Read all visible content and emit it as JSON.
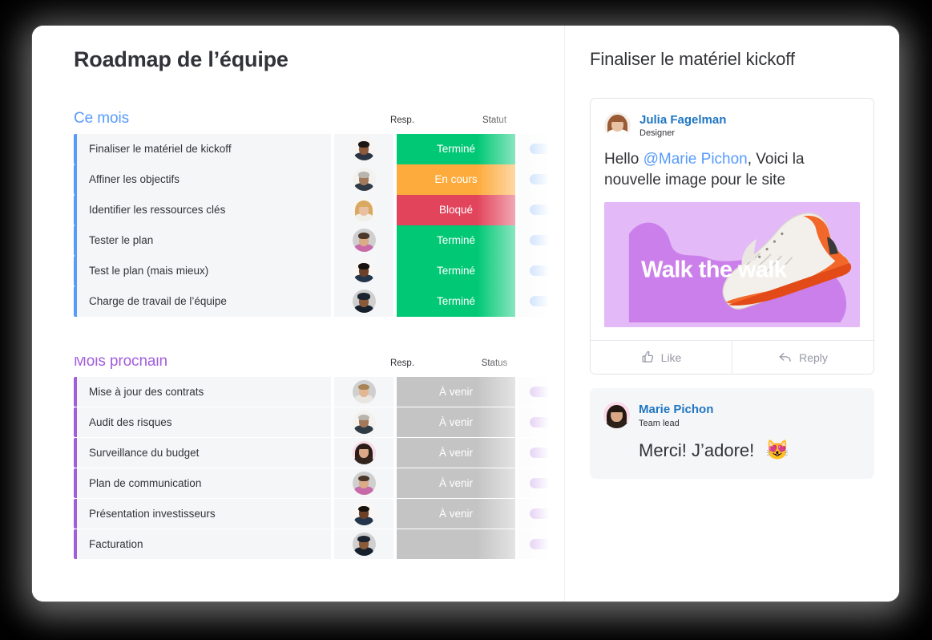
{
  "board": {
    "title": "Roadmap de l’équipe",
    "groups": [
      {
        "name": "Ce mois",
        "accent": "#579bfc",
        "columns": {
          "person": "Resp.",
          "status": "Statut"
        },
        "rows": [
          {
            "task": "Finaliser le matériel de kickoff",
            "status": "Terminé",
            "status_color": "#00c875",
            "progress": 100,
            "avatar": "man-dark-short-hair"
          },
          {
            "task": "Affiner les objectifs",
            "status": "En cours",
            "status_color": "#fdab3d",
            "progress": 100,
            "avatar": "man-grey-beard"
          },
          {
            "task": "Identifier les ressources clés",
            "status": "Bloqué",
            "status_color": "#e2445c",
            "progress": 45,
            "avatar": "woman-blonde"
          },
          {
            "task": "Tester le plan",
            "status": "Terminé",
            "status_color": "#00c875",
            "progress": 100,
            "avatar": "man-beard-floral"
          },
          {
            "task": "Test le plan (mais mieux)",
            "status": "Terminé",
            "status_color": "#00c875",
            "progress": 100,
            "avatar": "man-dark-skin-beard"
          },
          {
            "task": "Charge de travail de l’équipe",
            "status": "Terminé",
            "status_color": "#00c875",
            "progress": 100,
            "avatar": "man-turban"
          }
        ]
      },
      {
        "name": "Mois prochain",
        "accent": "#a25ddc",
        "columns": {
          "person": "Resp.",
          "status": "Status"
        },
        "rows": [
          {
            "task": "Mise à jour des contrats",
            "status": "À venir",
            "status_color": "#c4c4c4",
            "progress": 100,
            "avatar": "man-blond-short"
          },
          {
            "task": "Audit des risques",
            "status": "À venir",
            "status_color": "#c4c4c4",
            "progress": 100,
            "avatar": "man-grey-beard"
          },
          {
            "task": "Surveillance du budget",
            "status": "À venir",
            "status_color": "#c4c4c4",
            "progress": 45,
            "avatar": "woman-dark-hair-pink"
          },
          {
            "task": "Plan de communication",
            "status": "À venir",
            "status_color": "#c4c4c4",
            "progress": 100,
            "avatar": "man-beard-floral"
          },
          {
            "task": "Présentation investisseurs",
            "status": "À venir",
            "status_color": "#c4c4c4",
            "progress": 100,
            "avatar": "man-dark-skin-beard"
          },
          {
            "task": "Facturation",
            "status": "",
            "status_color": "#c4c4c4",
            "progress": 100,
            "avatar": "man-turban"
          }
        ]
      }
    ]
  },
  "updates": {
    "title": "Finaliser le matériel kickoff",
    "post": {
      "author": "Julia Fagelman",
      "role": "Designer",
      "text_before": "Hello ",
      "mention": "@Marie Pichon",
      "text_after": ", Voici la nouvelle image pour le site",
      "image": {
        "caption": "Walk the walk",
        "background_color": "#e3b9f7",
        "blob_color": "#c97ae8",
        "shoe_accent_color": "#f2682a"
      },
      "actions": [
        {
          "label": "Like",
          "icon": "thumbs-up-icon"
        },
        {
          "label": "Reply",
          "icon": "reply-arrow-icon"
        }
      ]
    },
    "reply": {
      "author": "Marie Pichon",
      "role": "Team lead",
      "text": "Merci! J’adore!",
      "emoji": "😻"
    }
  },
  "theme": {
    "accent_blue": "#579bfc",
    "accent_purple": "#a25ddc",
    "link_blue": "#1f76c2",
    "text": "#323338",
    "row_bg": "#f5f6f8"
  }
}
